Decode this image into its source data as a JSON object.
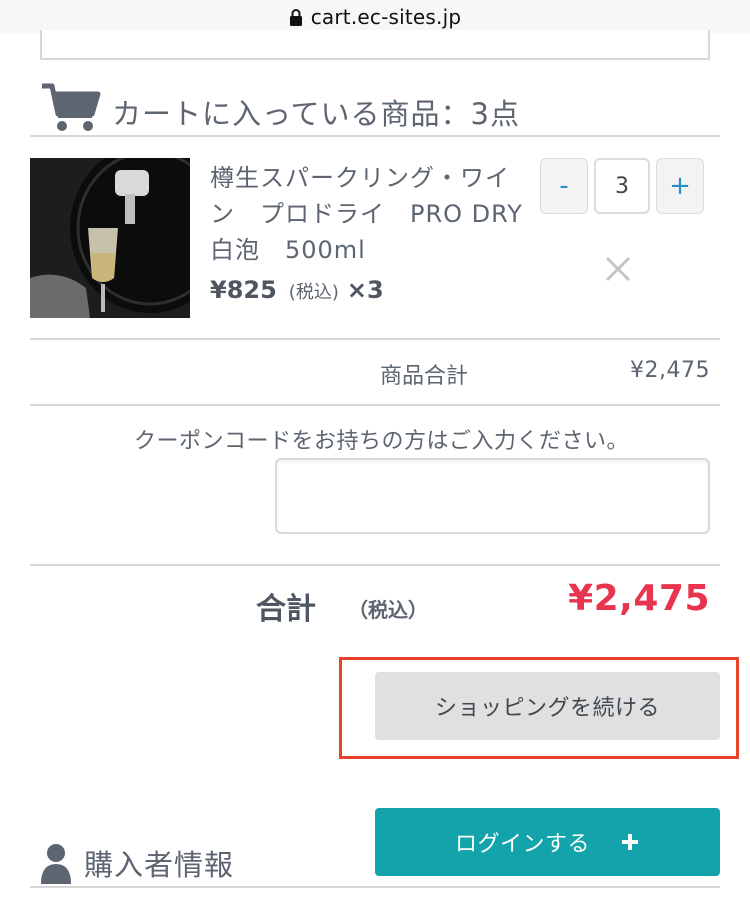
{
  "browser": {
    "url": "cart.ec-sites.jp",
    "lock_icon": "lock-icon"
  },
  "cart": {
    "icon": "cart-icon",
    "title": "カートに入っている商品：3点",
    "item": {
      "name": "樽生スパークリング・ワイン　プロドライ　PRO DRY　白泡　500ml",
      "price": "¥825",
      "tax_note": "(税込)",
      "qty_text": "×3",
      "quantity": "3",
      "minus_label": "-",
      "plus_label": "+",
      "remove_icon": "close-icon",
      "image_icon": "sparkling-wine-photo"
    }
  },
  "summary": {
    "subtotal_label": "商品合計",
    "subtotal_value": "¥2,475",
    "coupon_prompt": "クーポンコードをお持ちの方はご入力ください。",
    "coupon_value": "",
    "total_label": "合計",
    "total_tax": "（税込）",
    "total_value": "¥2,475"
  },
  "actions": {
    "continue_label": "ショッピングを続ける",
    "login_label": "ログインする",
    "login_icon": "plus-icon"
  },
  "buyer": {
    "icon": "person-icon",
    "title": "購入者情報"
  },
  "colors": {
    "accent_teal": "#13a3aa",
    "total_red": "#e8344e",
    "highlight_red": "#e8442a",
    "stepper_blue": "#2a8fc4"
  }
}
